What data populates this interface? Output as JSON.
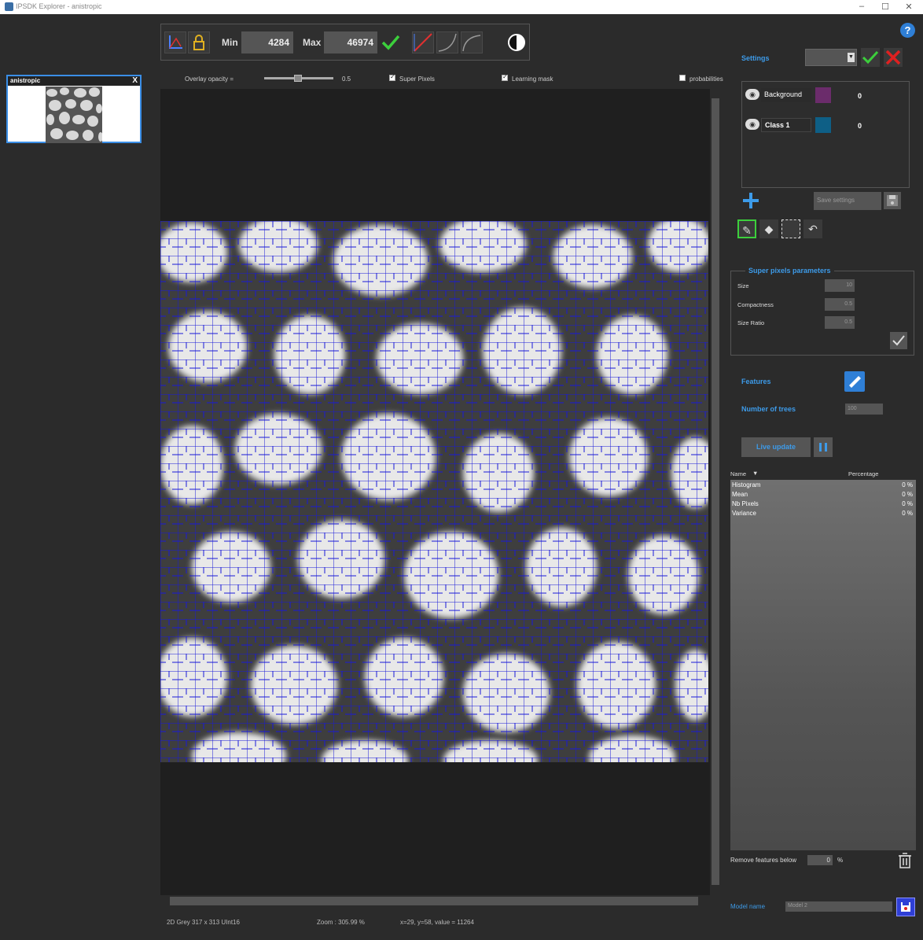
{
  "window": {
    "title": "IPSDK Explorer - anistropic",
    "controls": [
      "–",
      "☐",
      "✕"
    ]
  },
  "thumbnail": {
    "title": "anistropic",
    "close": "X"
  },
  "toolbar": {
    "min_label": "Min",
    "min_value": "4284",
    "max_label": "Max",
    "max_value": "46974"
  },
  "overlay": {
    "opacity_label": "Overlay opacity =",
    "opacity_value": "0.5",
    "opacity_level": 0.5,
    "super_pixels_label": "Super Pixels",
    "super_pixels_checked": true,
    "learning_mask_label": "Learning mask",
    "learning_mask_checked": true,
    "probabilities_label": "probabilities",
    "probabilities_checked": false
  },
  "status": {
    "image_info": "2D Grey 317 x 313 UInt16",
    "zoom": "Zoom : 305.99 %",
    "cursor": "x=29, y=58, value = 11264"
  },
  "right_panel": {
    "help": "?",
    "settings_label": "Settings",
    "classes": [
      {
        "name": "Background",
        "color": "#6b2c6b",
        "count": "0"
      },
      {
        "name": "Class 1",
        "color": "#0e5f86",
        "count": "0"
      }
    ],
    "save_settings": "Save settings",
    "super_pixels": {
      "title": "Super pixels parameters",
      "params": [
        {
          "label": "Size",
          "value": "10"
        },
        {
          "label": "Compactness",
          "value": "0.5"
        },
        {
          "label": "Size Ratio",
          "value": "0.5"
        }
      ]
    },
    "features_label": "Features",
    "trees_label": "Number of trees",
    "trees_value": "100",
    "live_update": "Live update",
    "list_header": {
      "name": "Name",
      "sort": "▼",
      "percentage": "Percentage"
    },
    "features": [
      {
        "name": "Histogram",
        "pct": "0 %"
      },
      {
        "name": "Mean",
        "pct": "0 %"
      },
      {
        "name": "Nb Pixels",
        "pct": "0 %"
      },
      {
        "name": "Variance",
        "pct": "0 %"
      }
    ],
    "remove_label": "Remove features below",
    "remove_value": "0",
    "remove_unit": "%",
    "model_label": "Model name",
    "model_value": "Model 2"
  },
  "colors": {
    "accent_blue": "#3d9be9",
    "check_green": "#3ccf3c",
    "cancel_red": "#e02020",
    "superpixel_line": "#1a1ad8"
  }
}
